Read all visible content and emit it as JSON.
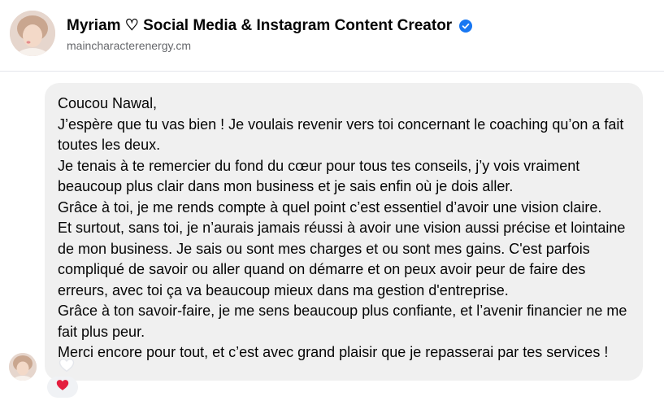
{
  "header": {
    "title": "Myriam ♡ Social Media & Instagram Content Creator",
    "subtitle": "maincharacterenergy.cm"
  },
  "message": {
    "lines": [
      "Coucou Nawal,",
      "J’espère que tu vas bien ! Je voulais revenir vers toi concernant le coaching qu’on a fait toutes les deux.",
      "Je tenais à te remercier du fond du cœur pour tous tes conseils, j’y vois vraiment beaucoup plus clair dans mon business et je sais enfin où je dois aller.",
      "Grâce à toi, je me rends compte à quel point c’est essentiel d’avoir une vision claire.",
      "Et surtout, sans toi, je n’aurais jamais réussi à avoir une vision aussi précise et lointaine de mon business. Je sais ou sont mes charges et ou sont mes gains. C'est parfois compliqué de savoir ou aller quand on démarre et on peux avoir peur de faire des erreurs, avec toi ça va beaucoup mieux dans ma gestion d'entreprise.",
      "Grâce à ton savoir-faire, je me sens beaucoup plus confiante, et l’avenir financier ne me fait plus peur.",
      "Merci encore pour tout, et c’est avec grand plaisir que je repasserai par tes services !"
    ]
  },
  "colors": {
    "verified": "#1877f2",
    "bubble": "#f0f0f0",
    "heart": "#e41e3f"
  },
  "icons": {
    "verified": "verified-badge-icon",
    "like": "heart-outline-icon",
    "reaction": "heart-reaction-icon"
  }
}
